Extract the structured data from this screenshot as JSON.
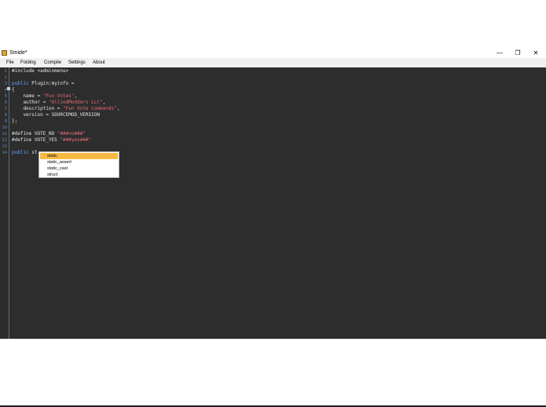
{
  "window": {
    "title": "Smide*",
    "minimize": "—",
    "restore": "❐",
    "close": "✕"
  },
  "menu": [
    "File",
    "Folding",
    "Compile",
    "Settings",
    "About"
  ],
  "editor": {
    "line_numbers": [
      "1",
      "2",
      "3",
      "4",
      "5",
      "6",
      "7",
      "8",
      "9",
      "10",
      "11",
      "12",
      "13",
      "14"
    ],
    "lines": [
      [
        {
          "t": "#include <adminmenu>",
          "c": ""
        }
      ],
      [],
      [
        {
          "t": "public",
          "c": "kw"
        },
        {
          "t": " Plugin:myinfo =",
          "c": ""
        }
      ],
      [
        {
          "t": "{",
          "c": ""
        }
      ],
      [
        {
          "t": "    name = ",
          "c": ""
        },
        {
          "t": "\"Fun Votes\"",
          "c": "str"
        },
        {
          "t": ",",
          "c": ""
        }
      ],
      [
        {
          "t": "    author = ",
          "c": ""
        },
        {
          "t": "\"AlliedModders LLC\"",
          "c": "str"
        },
        {
          "t": ",",
          "c": ""
        }
      ],
      [
        {
          "t": "    description = ",
          "c": ""
        },
        {
          "t": "\"Fun Vote Commands\"",
          "c": "str"
        },
        {
          "t": ",",
          "c": ""
        }
      ],
      [
        {
          "t": "    version = SOURCEMOD_VERSION",
          "c": ""
        }
      ],
      [
        {
          "t": "};",
          "c": ""
        }
      ],
      [],
      [
        {
          "t": "#define VOTE_NO ",
          "c": ""
        },
        {
          "t": "\"###no###\"",
          "c": "str"
        }
      ],
      [
        {
          "t": "#define VOTE_YES ",
          "c": ""
        },
        {
          "t": "\"###yes###\"",
          "c": "str"
        }
      ],
      [],
      [
        {
          "t": "public",
          "c": "kw"
        },
        {
          "t": " st",
          "c": ""
        }
      ]
    ]
  },
  "autocomplete": {
    "items": [
      "static",
      "static_assert",
      "static_cast",
      "struct"
    ],
    "selected": 0
  }
}
